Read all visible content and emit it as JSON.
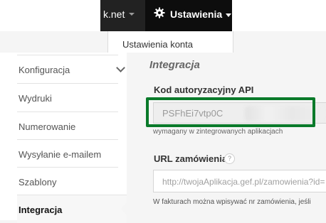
{
  "topbar": {
    "account_label": "k.net",
    "settings_label": "Ustawienia",
    "settings_icon": "gear-icon"
  },
  "dropdown": {
    "item": "Ustawienia konta"
  },
  "sidebar": {
    "items": [
      {
        "label": "Konfiguracja"
      },
      {
        "label": "Wydruki"
      },
      {
        "label": "Numerowanie"
      },
      {
        "label": "Wysyłanie e-mailem"
      },
      {
        "label": "Szablony"
      },
      {
        "label": "Integracja"
      }
    ],
    "active": "Integracja"
  },
  "main": {
    "title": "Integracja",
    "api": {
      "label": "Kod autoryzacyjny API",
      "value": "PSFhEi7vtp0C",
      "help": "wymagany w zintegrowanych aplikacjach"
    },
    "url": {
      "label": "URL zamówienia",
      "help_icon": "?",
      "placeholder": "http://twojaAplikacja.gef.pl/zamowienia?id=",
      "help": "W fakturach można wpisywać nr zamówienia, jeśli"
    }
  },
  "colors": {
    "highlight": "#0a7a2a",
    "topbar_dark": "#0d0d0d"
  }
}
